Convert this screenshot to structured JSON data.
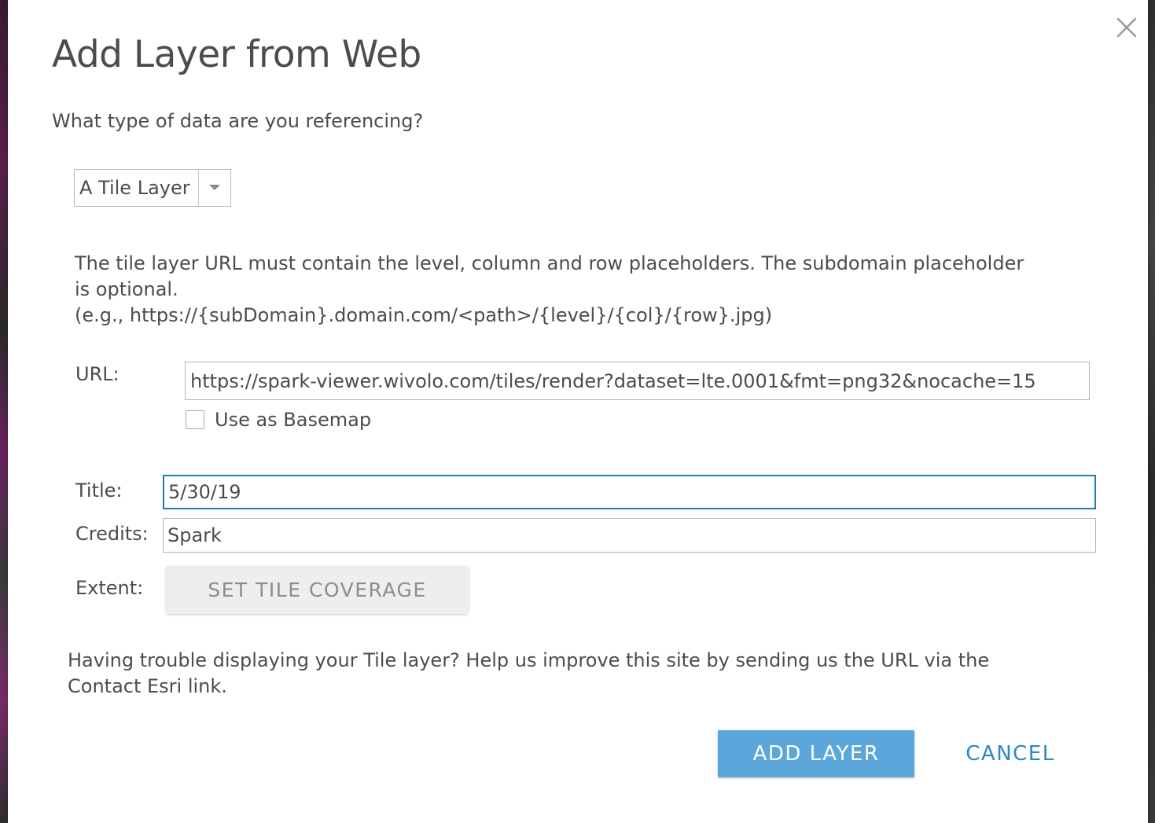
{
  "dialog": {
    "title": "Add Layer from Web",
    "close_icon": "close-icon",
    "question": "What type of data are you referencing?",
    "layer_type": {
      "selected": "A Tile Layer",
      "arrow_icon": "caret-down-icon"
    },
    "help_text": {
      "line1": "The tile layer URL must contain the level, column and row placeholders. The subdomain placeholder",
      "line2": "is optional.",
      "line3": "(e.g., https://{subDomain}.domain.com/<path>/{level}/{col}/{row}.jpg)"
    },
    "url": {
      "label": "URL:",
      "value": "https://spark-viewer.wivolo.com/tiles/render?dataset=lte.0001&fmt=png32&nocache=15"
    },
    "basemap": {
      "label": "Use as Basemap",
      "checked": false
    },
    "title_field": {
      "label": "Title:",
      "value": "5/30/19"
    },
    "credits_field": {
      "label": "Credits:",
      "value": "Spark"
    },
    "extent": {
      "label": "Extent:",
      "button_label": "SET TILE COVERAGE"
    },
    "trouble_text": {
      "line1": "Having trouble displaying your Tile layer? Help us improve this site by sending us the URL via the",
      "line2": "Contact Esri link."
    },
    "actions": {
      "add_label": "ADD LAYER",
      "cancel_label": "CANCEL"
    },
    "colors": {
      "primary_button": "#5ba7db",
      "link": "#2b88c6",
      "focus_border": "#1c7cb3",
      "text": "#4c4c4c"
    }
  }
}
